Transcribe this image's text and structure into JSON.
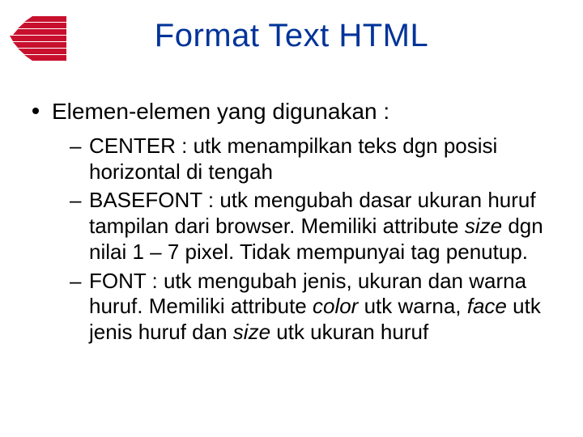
{
  "title": "Format Text HTML",
  "bullet1": "Elemen-elemen yang digunakan :",
  "item1": "CENTER : utk menampilkan teks dgn posisi horizontal di tengah",
  "item2a": "BASEFONT : utk mengubah dasar ukuran huruf tampilan dari browser. Memiliki attribute ",
  "item2b_italic": "size",
  "item2c": " dgn nilai 1 – 7 pixel. Tidak mempunyai tag penutup.",
  "item3a": "FONT : utk mengubah jenis, ukuran dan warna huruf. Memiliki attribute ",
  "item3b_italic": "color",
  "item3c": " utk warna, ",
  "item3d_italic": "face",
  "item3e": " utk jenis huruf dan ",
  "item3f_italic": "size",
  "item3g": " utk ukuran huruf",
  "dash": "–",
  "logo_color": "#C8102E"
}
